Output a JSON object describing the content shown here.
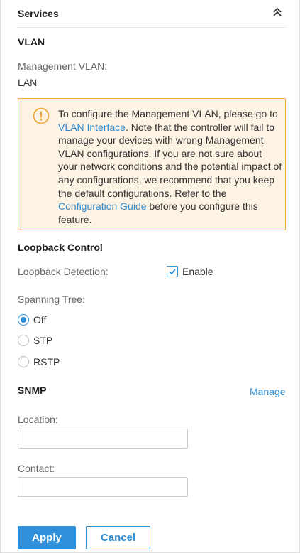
{
  "header": {
    "title": "Services",
    "collapse_icon": "double-chevron-up-icon"
  },
  "vlan": {
    "title": "VLAN",
    "mgmt_label": "Management VLAN:",
    "mgmt_value": "LAN",
    "notice": {
      "icon": "warning-icon",
      "accent_color": "#f0a93c",
      "text_before_link1": "To configure the Management VLAN, please go to ",
      "link1": "VLAN Interface",
      "text_after_link1": ". Note that the controller will fail to manage your devices with wrong Management VLAN configurations. If you are not sure about your network conditions and the potential impact of any configurations, we recommend that you keep the default configurations. Refer to the ",
      "link2": "Configuration Guide",
      "text_after_link2": " before you configure this feature."
    }
  },
  "loopback": {
    "title": "Loopback Control",
    "detection_label": "Loopback Detection:",
    "enable_label": "Enable",
    "enable_checked": true,
    "spanning_tree_label": "Spanning Tree:",
    "options": [
      {
        "label": "Off",
        "selected": true
      },
      {
        "label": "STP",
        "selected": false
      },
      {
        "label": "RSTP",
        "selected": false
      }
    ]
  },
  "snmp": {
    "title": "SNMP",
    "manage_link": "Manage",
    "location_label": "Location:",
    "location_value": "",
    "contact_label": "Contact:",
    "contact_value": ""
  },
  "actions": {
    "apply": "Apply",
    "cancel": "Cancel"
  },
  "colors": {
    "accent": "#2e8cd3",
    "primary_button": "#2f8fd8",
    "notice_bg": "#fdf3e4"
  }
}
